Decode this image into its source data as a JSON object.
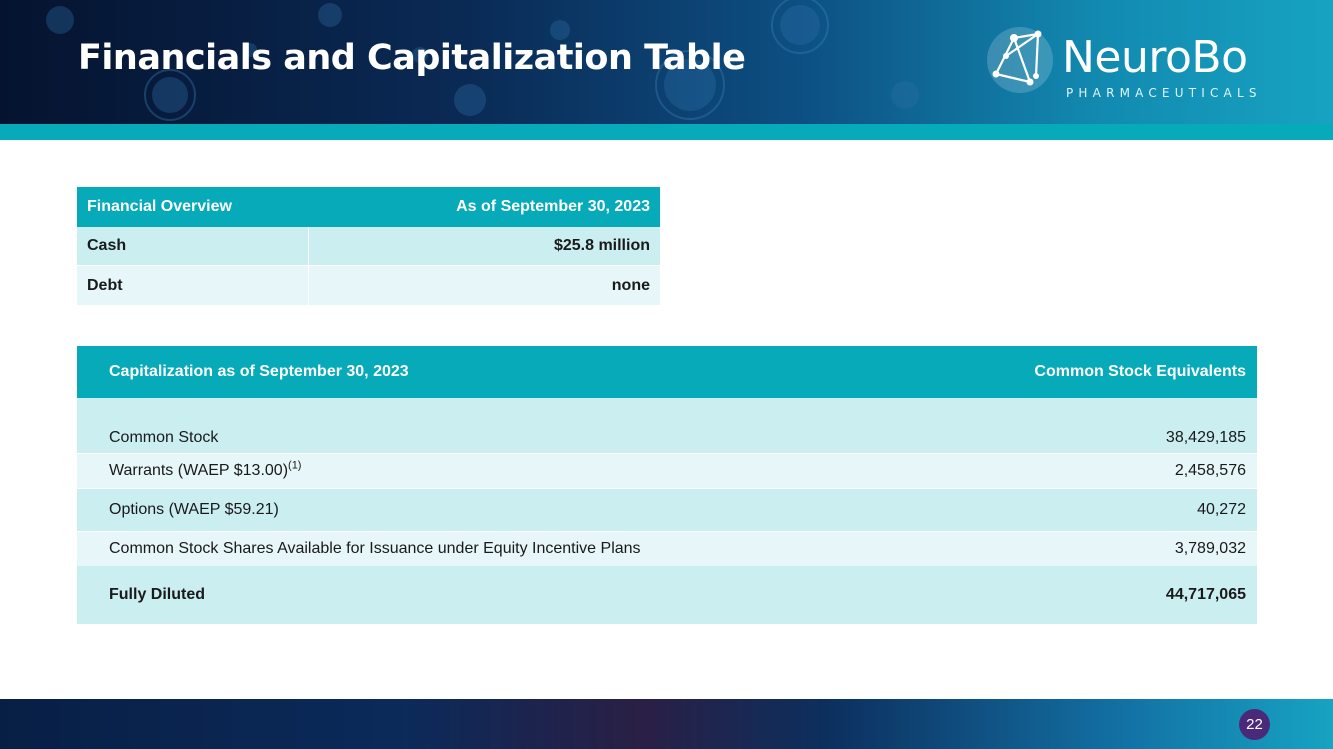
{
  "slide": {
    "title": "Financials and Capitalization Table",
    "page_number": "22"
  },
  "logo": {
    "name": "NeuroBo",
    "subtitle": "PHARMACEUTICALS"
  },
  "financial_overview": {
    "header": {
      "label": "Financial Overview",
      "date": "As of September 30, 2023"
    },
    "rows": [
      {
        "label": "Cash",
        "value": "$25.8 million"
      },
      {
        "label": "Debt",
        "value": "none"
      }
    ]
  },
  "capitalization": {
    "header": {
      "label": "Capitalization as of September 30, 2023",
      "value": "Common Stock Equivalents"
    },
    "rows": [
      {
        "label": "Common Stock",
        "value": "38,429,185"
      },
      {
        "label": "Warrants (WAEP $13.00)",
        "footnote": "(1)",
        "value": "2,458,576"
      },
      {
        "label": "Options (WAEP $59.21)",
        "value": "40,272"
      },
      {
        "label": "Common Stock Shares Available for Issuance under Equity Incentive Plans",
        "value": "3,789,032"
      },
      {
        "label": "Fully Diluted",
        "value": "44,717,065"
      }
    ]
  },
  "colors": {
    "header_dark": "#05132f",
    "header_light": "#17a3c2",
    "table_header": "#06aab9",
    "row_dark": "#cbeef1",
    "row_light": "#e7f6f8",
    "badge": "#4a2a78"
  }
}
